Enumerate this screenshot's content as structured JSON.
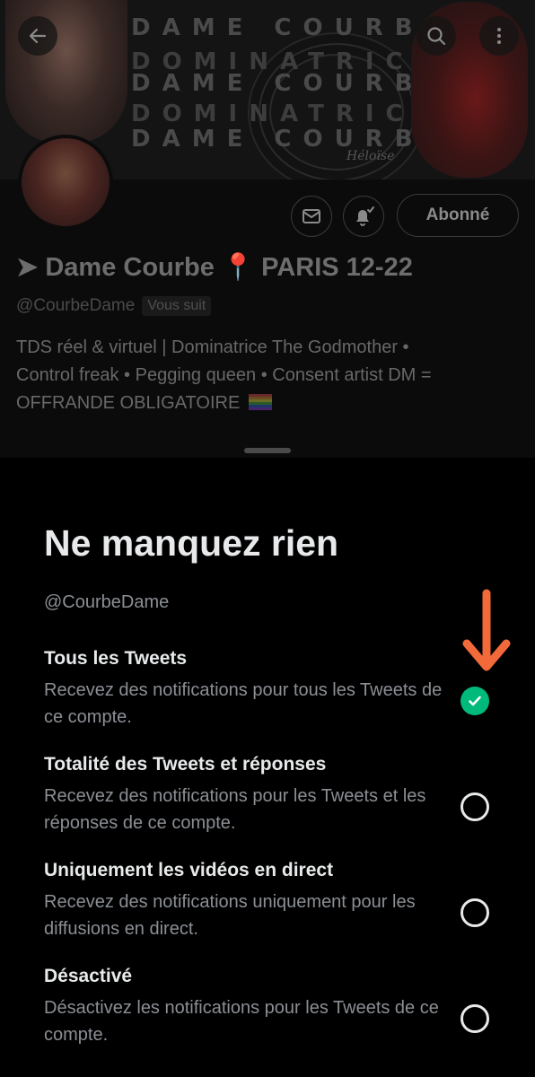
{
  "profile": {
    "banner_text": [
      "DAME COURBE",
      "DOMINATRICE",
      "DAME COURBE",
      "DOMINATRICE",
      "DAME COURBE"
    ],
    "banner_signature": "Héloïse",
    "display_name": "➤ Dame Courbe",
    "location_pin": "📍",
    "display_name_suffix": "PARIS 12-22",
    "handle": "@CourbeDame",
    "follows_you_badge": "Vous suit",
    "bio_line1": "TDS réel & virtuel | Dominatrice The Godmother •",
    "bio_line2": "Control freak • Pegging queen • Consent artist  DM =",
    "bio_line3": "OFFRANDE OBLIGATOIRE",
    "follow_button": "Abonné"
  },
  "sheet": {
    "title": "Ne manquez rien",
    "handle": "@CourbeDame",
    "options": [
      {
        "title": "Tous les Tweets",
        "description": "Recevez des notifications pour tous les Tweets de ce compte.",
        "selected": true
      },
      {
        "title": "Totalité des Tweets et réponses",
        "description": "Recevez des notifications pour les Tweets et les réponses de ce compte.",
        "selected": false
      },
      {
        "title": "Uniquement les vidéos en direct",
        "description": "Recevez des notifications uniquement pour les diffusions en direct.",
        "selected": false
      },
      {
        "title": "Désactivé",
        "description": "Désactivez les notifications pour les Tweets de ce compte.",
        "selected": false
      }
    ]
  },
  "colors": {
    "check_green": "#00ba7c",
    "annotation_arrow": "#f2693a"
  },
  "icons": [
    "back-arrow-icon",
    "search-icon",
    "more-vertical-icon",
    "mail-icon",
    "bell-check-icon",
    "checkmark-icon",
    "location-pin-icon",
    "rainbow-flag-icon"
  ]
}
